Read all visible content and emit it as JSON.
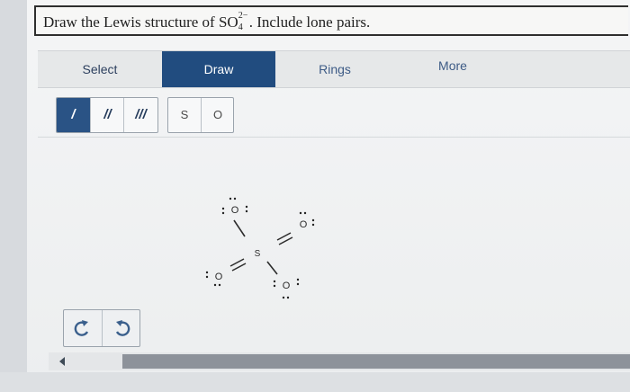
{
  "question": {
    "prefix": "Draw the Lewis structure of SO",
    "sub": "4",
    "sup": "2−",
    "suffix": ". Include lone pairs."
  },
  "tabs": [
    {
      "label": "Select"
    },
    {
      "label": "Draw"
    },
    {
      "label": "Rings"
    },
    {
      "label": "More"
    }
  ],
  "bond_tools": {
    "single": "/",
    "double": "//",
    "triple": "///"
  },
  "atom_tools": {
    "s": "S",
    "o": "O"
  },
  "molecule": {
    "center": "S",
    "oxygens": [
      "O",
      "O",
      "O",
      "O"
    ]
  },
  "colors": {
    "active_tab": "#214c7f",
    "active_bond": "#2a5385"
  },
  "icons": {
    "undo": "undo-icon",
    "redo": "redo-icon",
    "scroll_left": "arrow-left-icon"
  }
}
